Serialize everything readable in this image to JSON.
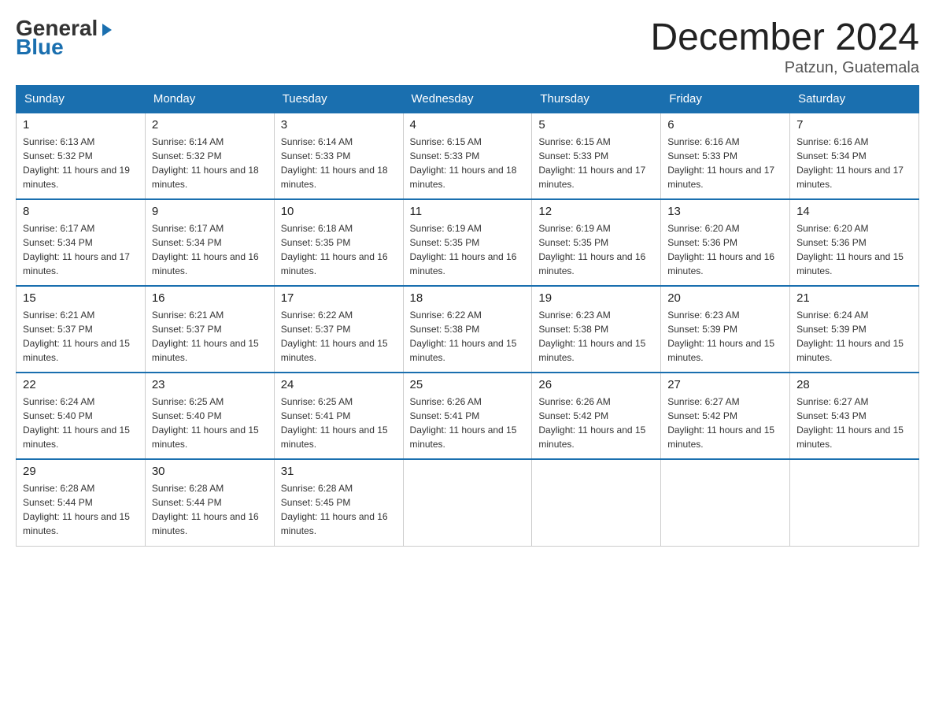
{
  "header": {
    "logo_general": "General",
    "logo_blue": "Blue",
    "month_title": "December 2024",
    "location": "Patzun, Guatemala"
  },
  "days_of_week": [
    "Sunday",
    "Monday",
    "Tuesday",
    "Wednesday",
    "Thursday",
    "Friday",
    "Saturday"
  ],
  "weeks": [
    [
      {
        "day": "1",
        "sunrise": "6:13 AM",
        "sunset": "5:32 PM",
        "daylight": "11 hours and 19 minutes."
      },
      {
        "day": "2",
        "sunrise": "6:14 AM",
        "sunset": "5:32 PM",
        "daylight": "11 hours and 18 minutes."
      },
      {
        "day": "3",
        "sunrise": "6:14 AM",
        "sunset": "5:33 PM",
        "daylight": "11 hours and 18 minutes."
      },
      {
        "day": "4",
        "sunrise": "6:15 AM",
        "sunset": "5:33 PM",
        "daylight": "11 hours and 18 minutes."
      },
      {
        "day": "5",
        "sunrise": "6:15 AM",
        "sunset": "5:33 PM",
        "daylight": "11 hours and 17 minutes."
      },
      {
        "day": "6",
        "sunrise": "6:16 AM",
        "sunset": "5:33 PM",
        "daylight": "11 hours and 17 minutes."
      },
      {
        "day": "7",
        "sunrise": "6:16 AM",
        "sunset": "5:34 PM",
        "daylight": "11 hours and 17 minutes."
      }
    ],
    [
      {
        "day": "8",
        "sunrise": "6:17 AM",
        "sunset": "5:34 PM",
        "daylight": "11 hours and 17 minutes."
      },
      {
        "day": "9",
        "sunrise": "6:17 AM",
        "sunset": "5:34 PM",
        "daylight": "11 hours and 16 minutes."
      },
      {
        "day": "10",
        "sunrise": "6:18 AM",
        "sunset": "5:35 PM",
        "daylight": "11 hours and 16 minutes."
      },
      {
        "day": "11",
        "sunrise": "6:19 AM",
        "sunset": "5:35 PM",
        "daylight": "11 hours and 16 minutes."
      },
      {
        "day": "12",
        "sunrise": "6:19 AM",
        "sunset": "5:35 PM",
        "daylight": "11 hours and 16 minutes."
      },
      {
        "day": "13",
        "sunrise": "6:20 AM",
        "sunset": "5:36 PM",
        "daylight": "11 hours and 16 minutes."
      },
      {
        "day": "14",
        "sunrise": "6:20 AM",
        "sunset": "5:36 PM",
        "daylight": "11 hours and 15 minutes."
      }
    ],
    [
      {
        "day": "15",
        "sunrise": "6:21 AM",
        "sunset": "5:37 PM",
        "daylight": "11 hours and 15 minutes."
      },
      {
        "day": "16",
        "sunrise": "6:21 AM",
        "sunset": "5:37 PM",
        "daylight": "11 hours and 15 minutes."
      },
      {
        "day": "17",
        "sunrise": "6:22 AM",
        "sunset": "5:37 PM",
        "daylight": "11 hours and 15 minutes."
      },
      {
        "day": "18",
        "sunrise": "6:22 AM",
        "sunset": "5:38 PM",
        "daylight": "11 hours and 15 minutes."
      },
      {
        "day": "19",
        "sunrise": "6:23 AM",
        "sunset": "5:38 PM",
        "daylight": "11 hours and 15 minutes."
      },
      {
        "day": "20",
        "sunrise": "6:23 AM",
        "sunset": "5:39 PM",
        "daylight": "11 hours and 15 minutes."
      },
      {
        "day": "21",
        "sunrise": "6:24 AM",
        "sunset": "5:39 PM",
        "daylight": "11 hours and 15 minutes."
      }
    ],
    [
      {
        "day": "22",
        "sunrise": "6:24 AM",
        "sunset": "5:40 PM",
        "daylight": "11 hours and 15 minutes."
      },
      {
        "day": "23",
        "sunrise": "6:25 AM",
        "sunset": "5:40 PM",
        "daylight": "11 hours and 15 minutes."
      },
      {
        "day": "24",
        "sunrise": "6:25 AM",
        "sunset": "5:41 PM",
        "daylight": "11 hours and 15 minutes."
      },
      {
        "day": "25",
        "sunrise": "6:26 AM",
        "sunset": "5:41 PM",
        "daylight": "11 hours and 15 minutes."
      },
      {
        "day": "26",
        "sunrise": "6:26 AM",
        "sunset": "5:42 PM",
        "daylight": "11 hours and 15 minutes."
      },
      {
        "day": "27",
        "sunrise": "6:27 AM",
        "sunset": "5:42 PM",
        "daylight": "11 hours and 15 minutes."
      },
      {
        "day": "28",
        "sunrise": "6:27 AM",
        "sunset": "5:43 PM",
        "daylight": "11 hours and 15 minutes."
      }
    ],
    [
      {
        "day": "29",
        "sunrise": "6:28 AM",
        "sunset": "5:44 PM",
        "daylight": "11 hours and 15 minutes."
      },
      {
        "day": "30",
        "sunrise": "6:28 AM",
        "sunset": "5:44 PM",
        "daylight": "11 hours and 16 minutes."
      },
      {
        "day": "31",
        "sunrise": "6:28 AM",
        "sunset": "5:45 PM",
        "daylight": "11 hours and 16 minutes."
      },
      null,
      null,
      null,
      null
    ]
  ],
  "labels": {
    "sunrise_prefix": "Sunrise: ",
    "sunset_prefix": "Sunset: ",
    "daylight_prefix": "Daylight: "
  }
}
